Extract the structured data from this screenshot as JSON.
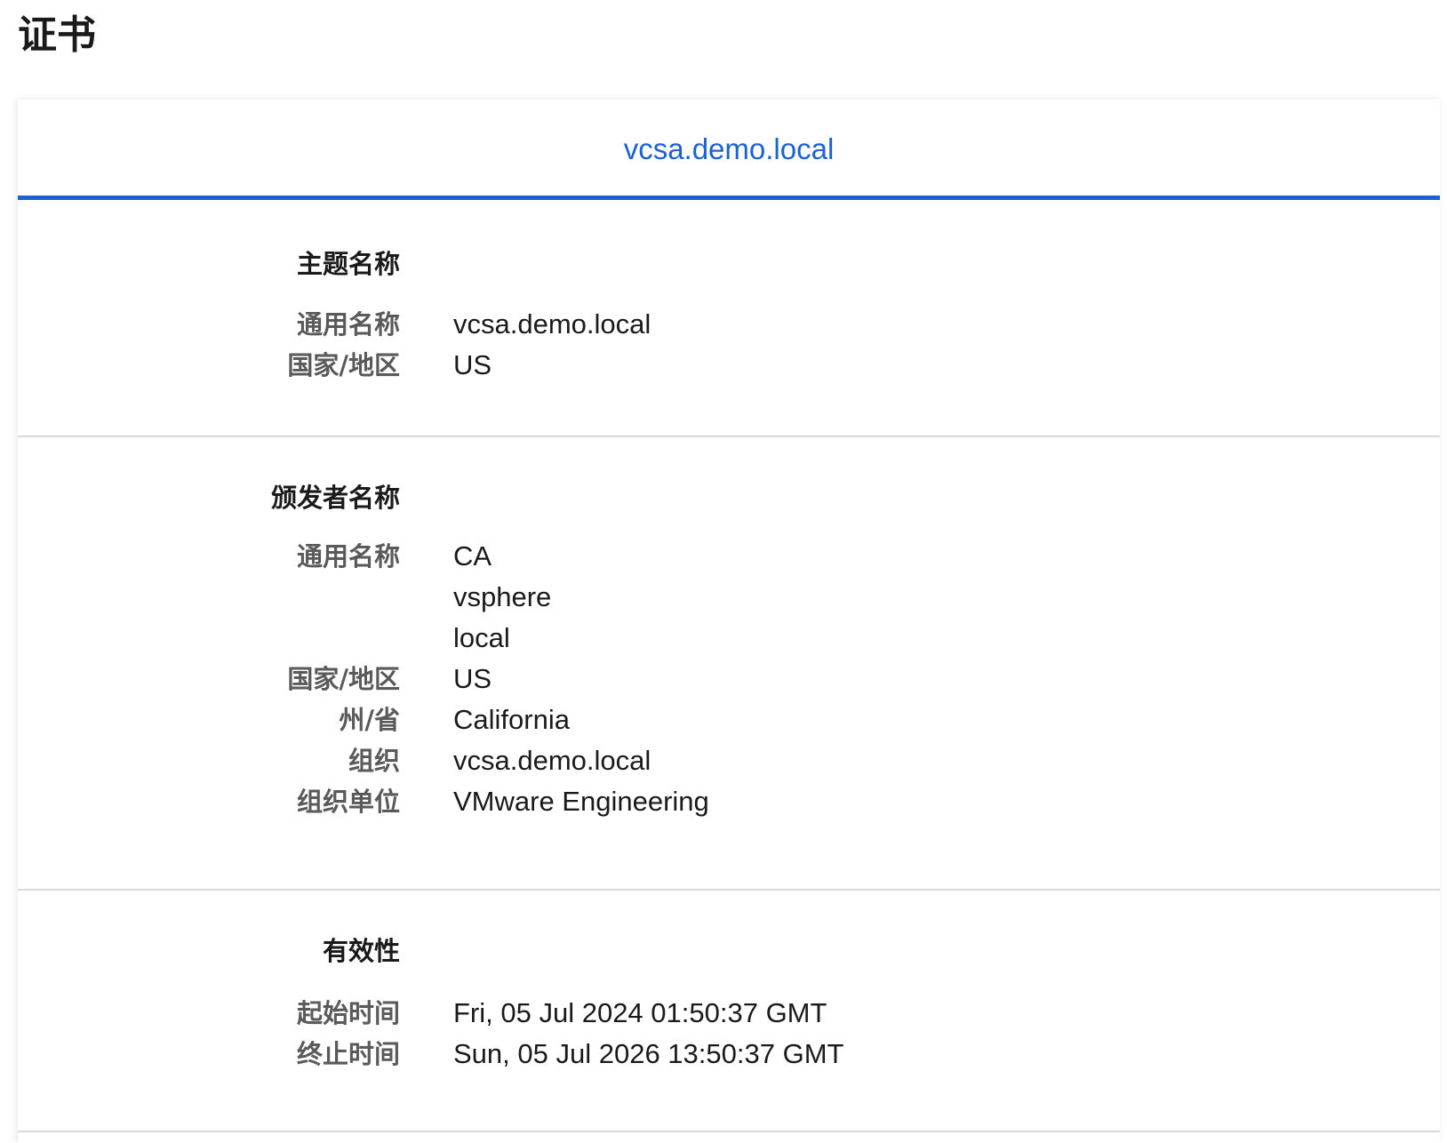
{
  "page": {
    "title": "证书"
  },
  "tabs": [
    {
      "label": "vcsa.demo.local",
      "active": true
    }
  ],
  "accent_color": "#1a62d6",
  "subject": {
    "heading": "主题名称",
    "rows": [
      {
        "label": "通用名称",
        "value": "vcsa.demo.local"
      },
      {
        "label": "国家/地区",
        "value": "US"
      }
    ]
  },
  "issuer": {
    "heading": "颁发者名称",
    "rows": [
      {
        "label": "通用名称",
        "value": "CA"
      },
      {
        "label": "",
        "value": "vsphere"
      },
      {
        "label": "",
        "value": "local"
      },
      {
        "label": "国家/地区",
        "value": "US"
      },
      {
        "label": "州/省",
        "value": "California"
      },
      {
        "label": "组织",
        "value": "vcsa.demo.local"
      },
      {
        "label": "组织单位",
        "value": "VMware Engineering"
      }
    ]
  },
  "validity": {
    "heading": "有效性",
    "rows": [
      {
        "label": "起始时间",
        "value": "Fri, 05 Jul 2024 01:50:37 GMT"
      },
      {
        "label": "终止时间",
        "value": "Sun, 05 Jul 2026 13:50:37 GMT"
      }
    ]
  }
}
